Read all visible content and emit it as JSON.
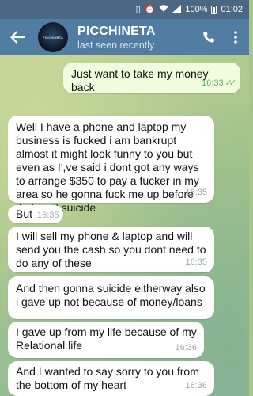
{
  "status_bar": {
    "battery_percent": "100%",
    "time": "01:02"
  },
  "header": {
    "title": "PICCHINETA",
    "subtitle": "last seen recently",
    "avatar_text": "PICCHINETA"
  },
  "messages": [
    {
      "direction": "out",
      "text": "Just want to take my money back",
      "time": "16:33",
      "read": true
    },
    {
      "direction": "in",
      "text": "Well I have a phone and laptop my business is fucked i am bankrupt almost it might look funny to you but even as I',ve said  i dont got any ways to arrange $350 to pay  a fucker in my area so he gonna fuck me up before that i will suicide",
      "time": "16:35"
    },
    {
      "direction": "in",
      "text": "But",
      "time": "16:35"
    },
    {
      "direction": "in",
      "text": "I will sell my phone & laptop and will send you the cash so you dont need to do any of these",
      "time": "16:35"
    },
    {
      "direction": "in",
      "text": "And then gonna suicide eitherway also i gave up not because of money/loans",
      "time": ""
    },
    {
      "direction": "in",
      "text": "I gave up from my life because of my Relational life",
      "time": "16:36"
    },
    {
      "direction": "in",
      "text": "And I wanted to say sorry to you from the bottom of my heart",
      "time": "16:36"
    }
  ]
}
